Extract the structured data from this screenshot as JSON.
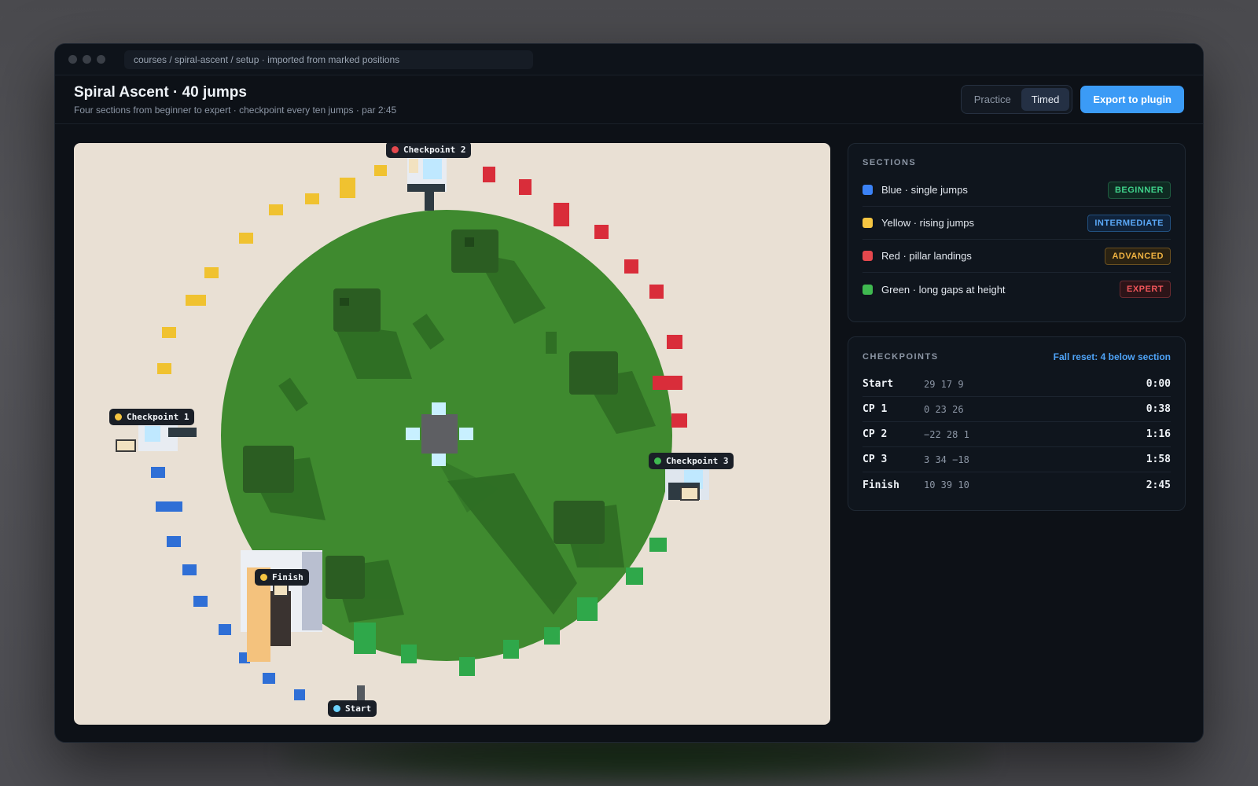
{
  "window": {
    "path": "courses / spiral-ascent / setup · imported from marked positions"
  },
  "header": {
    "title": "Spiral Ascent · 40 jumps",
    "subtitle": "Four sections from beginner to expert · checkpoint every ten jumps · par 2:45",
    "modes": [
      "Practice",
      "Timed"
    ],
    "active_mode": "Timed",
    "export_label": "Export to plugin"
  },
  "map": {
    "markers": [
      {
        "label": "Checkpoint 2",
        "color": "#e5484d"
      },
      {
        "label": "Checkpoint 1",
        "color": "#f5c542"
      },
      {
        "label": "Checkpoint 3",
        "color": "#3fb950"
      },
      {
        "label": "Finish",
        "color": "#f5c542"
      },
      {
        "label": "Start",
        "color": "#6dd3ff"
      }
    ],
    "colors": {
      "background": "#e9e0d4",
      "grass": "#3f8a2f",
      "blue": "#2f6fd6",
      "yellow": "#f0c230",
      "red": "#d92d3a",
      "green": "#2fa84a"
    }
  },
  "sections": {
    "title": "SECTIONS",
    "items": [
      {
        "label": "Blue · single jumps",
        "swatch": "#3b82f6",
        "badge": "BEGINNER",
        "badge_fg": "#3fd18a",
        "badge_bg": "#0f2a22",
        "badge_border": "#1f5a40"
      },
      {
        "label": "Yellow · rising jumps",
        "swatch": "#f5c542",
        "badge": "INTERMEDIATE",
        "badge_fg": "#5aa8f7",
        "badge_bg": "#10233b",
        "badge_border": "#22507f"
      },
      {
        "label": "Red · pillar landings",
        "swatch": "#e5484d",
        "badge": "ADVANCED",
        "badge_fg": "#f0b341",
        "badge_bg": "#2a2212",
        "badge_border": "#6a5020"
      },
      {
        "label": "Green · long gaps at height",
        "swatch": "#3fb950",
        "badge": "EXPERT",
        "badge_fg": "#f0555a",
        "badge_bg": "#2c1418",
        "badge_border": "#6a2a30"
      }
    ]
  },
  "checkpoints": {
    "title": "CHECKPOINTS",
    "action": "Fall reset: 4 below section",
    "rows": [
      {
        "name": "Start",
        "coords": "29 17 9",
        "time": "0:00"
      },
      {
        "name": "CP 1",
        "coords": "0 23 26",
        "time": "0:38"
      },
      {
        "name": "CP 2",
        "coords": "−22 28 1",
        "time": "1:16"
      },
      {
        "name": "CP 3",
        "coords": "3 34 −18",
        "time": "1:58"
      },
      {
        "name": "Finish",
        "coords": "10 39 10",
        "time": "2:45"
      }
    ]
  }
}
